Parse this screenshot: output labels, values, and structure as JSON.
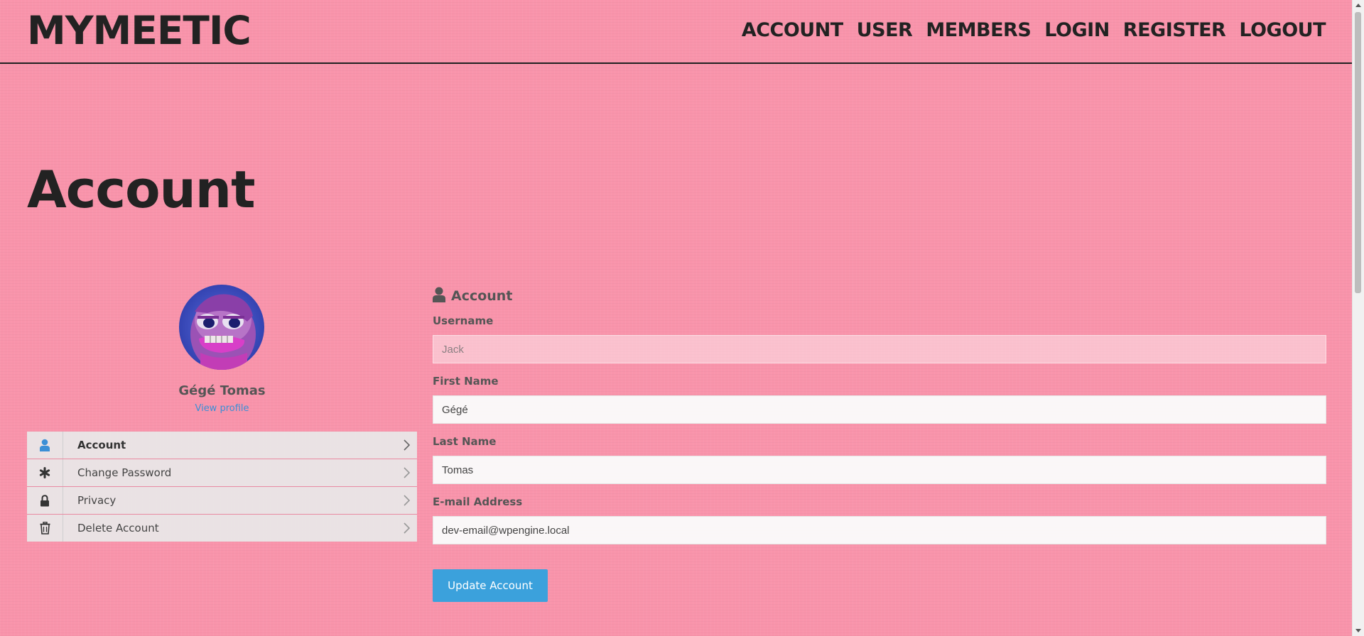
{
  "site": {
    "logo": "MYMEETIC"
  },
  "nav": {
    "items": [
      "ACCOUNT",
      "USER",
      "MEMBERS",
      "LOGIN",
      "REGISTER",
      "LOGOUT"
    ]
  },
  "page": {
    "title": "Account"
  },
  "profile": {
    "name": "Gégé Tomas",
    "view_profile": "View profile"
  },
  "side_menu": {
    "items": [
      {
        "label": "Account",
        "icon": "user-icon",
        "active": true
      },
      {
        "label": "Change Password",
        "icon": "asterisk-icon",
        "active": false
      },
      {
        "label": "Privacy",
        "icon": "lock-icon",
        "active": false
      },
      {
        "label": "Delete Account",
        "icon": "trash-icon",
        "active": false
      }
    ]
  },
  "form": {
    "heading": "Account",
    "fields": {
      "username": {
        "label": "Username",
        "value": "Jack",
        "disabled": true
      },
      "first_name": {
        "label": "First Name",
        "value": "Gégé"
      },
      "last_name": {
        "label": "Last Name",
        "value": "Tomas"
      },
      "email": {
        "label": "E-mail Address",
        "value": "dev-email@wpengine.local"
      }
    },
    "submit_label": "Update Account"
  },
  "colors": {
    "background": "#f994ab",
    "accent": "#3ba1dc",
    "text": "#222222"
  }
}
